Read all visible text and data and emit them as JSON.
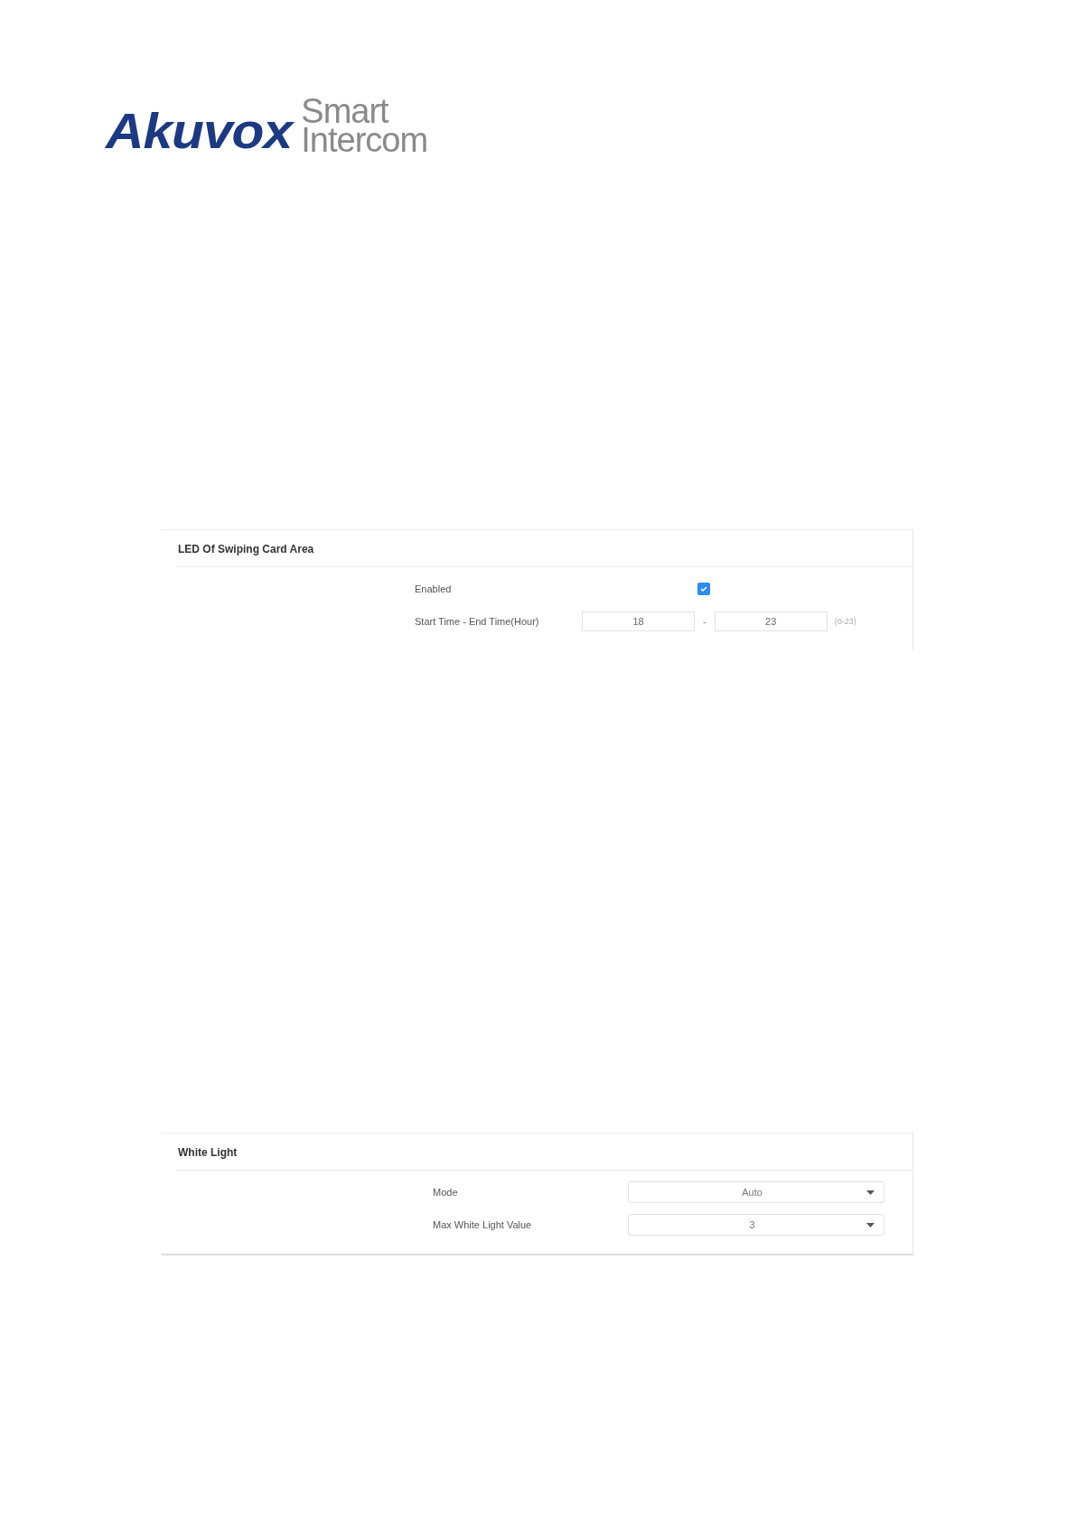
{
  "logo": {
    "brand": "Akuvox",
    "tagline": [
      "Smart",
      "Intercom"
    ]
  },
  "panels": [
    {
      "title": "LED Of Swiping Card Area",
      "rows": [
        {
          "kind": "checkbox",
          "label": "Enabled",
          "checked": true
        },
        {
          "kind": "range",
          "label": "Start Time - End Time(Hour)",
          "start": "18",
          "separator": "-",
          "end": "23",
          "hint": "(0-23)"
        }
      ]
    },
    {
      "title": "White Light",
      "rows": [
        {
          "kind": "select",
          "label": "Mode",
          "value": "Auto"
        },
        {
          "kind": "select",
          "label": "Max White Light Value",
          "value": "3"
        }
      ]
    }
  ]
}
